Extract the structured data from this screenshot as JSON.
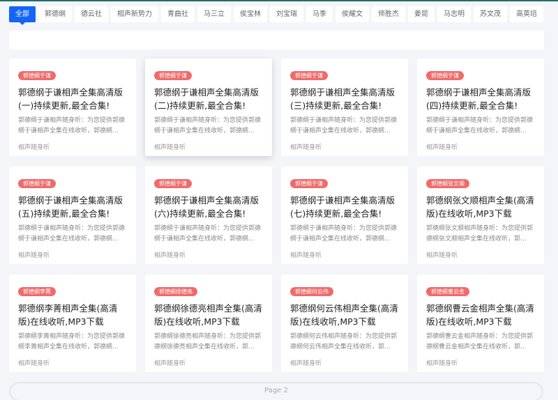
{
  "tabs": [
    "全部",
    "郭德纲",
    "德云社",
    "相声新势力",
    "青曲社",
    "马三立",
    "侯宝林",
    "刘宝瑞",
    "马季",
    "侯耀文",
    "师胜杰",
    "姜昆",
    "马志明",
    "苏文茂",
    "高英培"
  ],
  "cards": [
    {
      "badge": "郭德纲于谦",
      "title": "郭德纲于谦相声全集高清版(一)持续更新,最全合集!",
      "desc": "郭德纲于谦相声随身听：为您提供郭德纲于谦相声全集在线收听，郭德纲...",
      "source": "相声随身听"
    },
    {
      "badge": "郭德纲于谦",
      "title": "郭德纲于谦相声全集高清版(二)持续更新,最全合集!",
      "desc": "郭德纲于谦相声随身听：为您提供郭德纲于谦相声全集在线收听，郭德纲...",
      "source": "相声随身听"
    },
    {
      "badge": "郭德纲于谦",
      "title": "郭德纲于谦相声全集高清版(三)持续更新,最全合集!",
      "desc": "郭德纲于谦相声随身听：为您提供郭德纲于谦相声全集在线收听，郭德纲...",
      "source": "相声随身听"
    },
    {
      "badge": "郭德纲于谦",
      "title": "郭德纲于谦相声全集高清版(四)持续更新,最全合集!",
      "desc": "郭德纲于谦相声随身听：为您提供郭德纲于谦相声全集在线收听，郭德纲...",
      "source": "相声随身听"
    },
    {
      "badge": "郭德纲于谦",
      "title": "郭德纲于谦相声全集高清版(五)持续更新,最全合集!",
      "desc": "郭德纲于谦相声随身听：为您提供郭德纲于谦相声全集在线收听，郭德纲...",
      "source": "相声随身听"
    },
    {
      "badge": "郭德纲于谦",
      "title": "郭德纲于谦相声全集高清版(六)持续更新,最全合集!",
      "desc": "郭德纲于谦相声随身听：为您提供郭德纲于谦相声全集在线收听，郭德纲...",
      "source": "相声随身听"
    },
    {
      "badge": "郭德纲于谦",
      "title": "郭德纲于谦相声全集高清版(七)持续更新,最全合集!",
      "desc": "郭德纲于谦相声随身听：为您提供郭德纲于谦相声全集在线收听，郭德纲...",
      "source": "相声随身听"
    },
    {
      "badge": "郭德纲张文顺",
      "title": "郭德纲张文顺相声全集(高清版)在线收听,MP3下载",
      "desc": "郭德纲张文顺相声随身听：为您提供郭德纲张文顺相声全集在线收听，郭...",
      "source": "相声随身听"
    },
    {
      "badge": "郭德纲李菁",
      "title": "郭德纲李菁相声全集(高清版)在线收听,MP3下载",
      "desc": "郭德纲李菁相声随身听：为您提供郭德纲李菁相声全集在线收听，郭德纲...",
      "source": "相声随身听"
    },
    {
      "badge": "郭德纲徐德亮",
      "title": "郭德纲徐德亮相声全集(高清版)在线收听,MP3下载",
      "desc": "郭德纲徐德亮相声随身听：为您提供郭德纲徐德亮相声全集在线收听，郭...",
      "source": "相声随身听"
    },
    {
      "badge": "郭德纲何云伟",
      "title": "郭德纲何云伟相声全集(高清版)在线收听,MP3下载",
      "desc": "郭德纲何云伟相声随身听：为您提供郭德纲何云伟相声全集在线收听，郭...",
      "source": "相声随身听"
    },
    {
      "badge": "郭德纲曹云金",
      "title": "郭德纲曹云金相声全集(高清版)在线收听,MP3下载",
      "desc": "郭德纲曹云金相声随身听：为您提供郭德纲曹云金相声全集在线收听，郭...",
      "source": "相声随身听"
    }
  ],
  "pager": {
    "label": "Page 2"
  },
  "colors": {
    "active_tab": "#1565f5",
    "badge": "#ef6b6b",
    "top_border": "#1f6f6a"
  }
}
